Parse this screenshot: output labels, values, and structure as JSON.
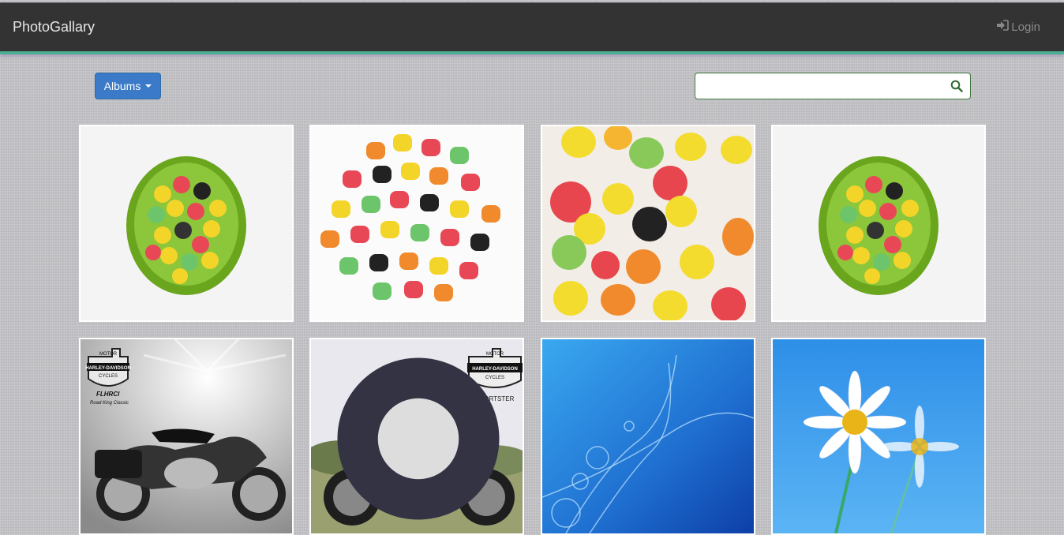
{
  "navbar": {
    "brand": "PhotoGallary",
    "login_label": "Login",
    "login_icon": "sign-in-icon"
  },
  "toolbar": {
    "albums_label": "Albums",
    "search_placeholder": "",
    "search_icon": "search-icon"
  },
  "gallery": {
    "photos": [
      {
        "subject": "bowl-of-gumdrops"
      },
      {
        "subject": "pile-of-gumdrops"
      },
      {
        "subject": "sugared-gumdrops-closeup"
      },
      {
        "subject": "bowl-of-gumdrops"
      },
      {
        "subject": "harley-davidson-road-king",
        "logo_top": "MOTOR",
        "logo_mid": "HARLEY-DAVIDSON",
        "logo_bottom": "CYCLES",
        "caption_1": "FLHRCI",
        "caption_2": "Road King Classic"
      },
      {
        "subject": "harley-davidson-sportster",
        "logo_top": "MOTOR",
        "logo_mid": "HARLEY-DAVIDSON",
        "logo_bottom": "CYCLES",
        "caption_1": "SPORTSTER"
      },
      {
        "subject": "blue-abstract-wallpaper"
      },
      {
        "subject": "daisy-flowers"
      }
    ]
  },
  "colors": {
    "navbar": "#333333",
    "navbar_accent": "#4caf94",
    "primary_button": "#3a7ac8",
    "search_border": "#3c763d"
  }
}
